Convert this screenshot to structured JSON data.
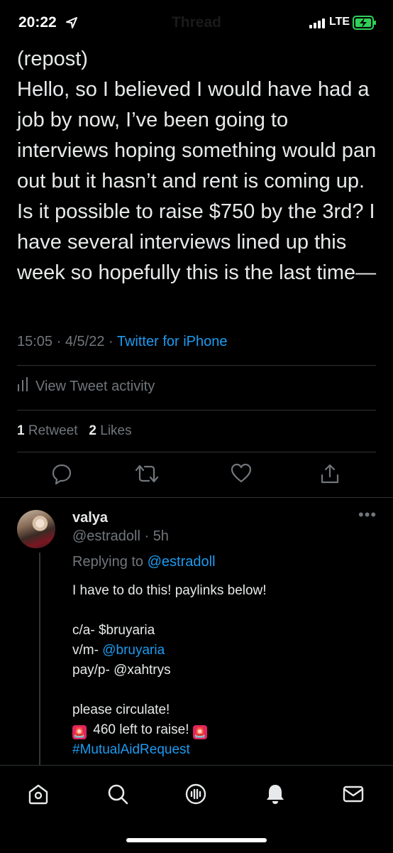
{
  "status_bar": {
    "time": "20:22",
    "network": "LTE"
  },
  "nav": {
    "title": "Thread"
  },
  "tweet": {
    "text_lines": [
      "(repost)",
      "Hello, so I believed I would have had a job by now, I’ve been going to interviews hoping something would pan out but it hasn’t and rent is coming up. Is it possible to raise $750 by the 3rd? I have several interviews lined up this week so hopefully this is the last time—"
    ],
    "time": "15:05",
    "date": "4/5/22",
    "source": "Twitter for iPhone",
    "activity_label": "View Tweet activity",
    "retweet_count": "1",
    "retweet_label": "Retweet",
    "like_count": "2",
    "like_label": "Likes"
  },
  "reply": {
    "name": "valya",
    "handle": "@estradoll",
    "age": "5h",
    "replying_prefix": "Replying to",
    "replying_handle": "@estradoll",
    "line1": "I have to do this! paylinks below!",
    "ca_prefix": "c/a- $bruyaria",
    "vm_prefix": "v/m- ",
    "vm_handle": "@bruyaria",
    "pp": "pay/p- @xahtrys",
    "circulate": "please circulate!",
    "left_to_raise": "460 left to raise!",
    "hashtag": "#MutualAidRequest"
  },
  "icons": [
    "location-arrow-icon",
    "signal-icon",
    "battery-charging-icon",
    "bar-chart-icon",
    "reply-icon",
    "retweet-icon",
    "like-icon",
    "share-icon",
    "more-icon",
    "home-icon",
    "search-icon",
    "spaces-icon",
    "notifications-icon",
    "messages-icon",
    "siren-icon"
  ],
  "colors": {
    "accent": "#1d9bf0",
    "muted": "#71767b",
    "text": "#e7e9ea",
    "battery": "#30d158"
  }
}
